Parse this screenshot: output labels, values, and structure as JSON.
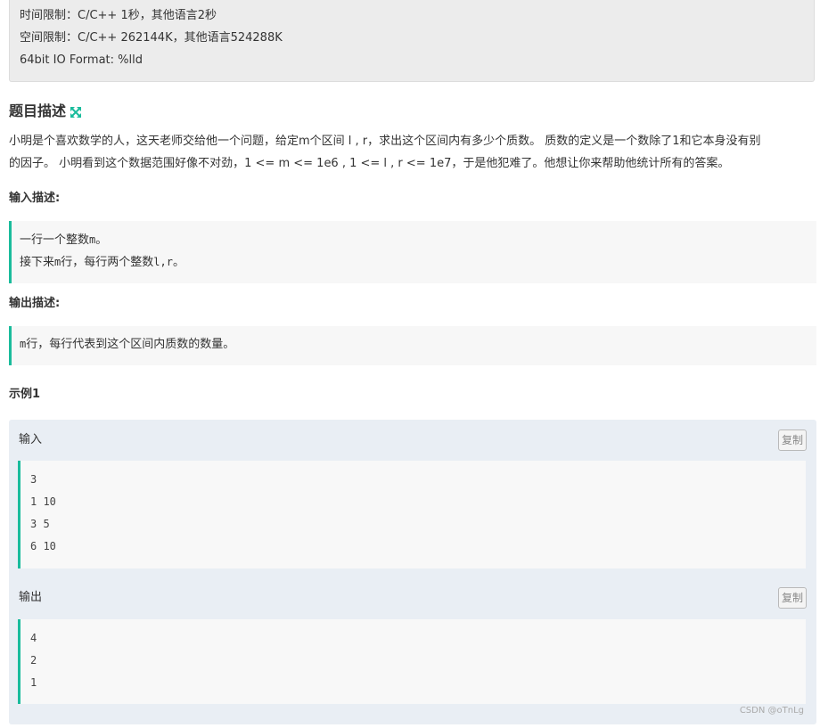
{
  "limits": {
    "time": "时间限制：C/C++ 1秒，其他语言2秒",
    "space": "空间限制：C/C++ 262144K，其他语言524288K",
    "format": "64bit IO Format: %lld"
  },
  "description": {
    "title": "题目描述",
    "text_line1": "小明是个喜欢数学的人，这天老师交给他一个问题，给定m个区间 l , r，求出这个区间内有多少个质数。 质数的定义是一个数除了1和它本身没有别",
    "text_line2": "的因子。 小明看到这个数据范围好像不对劲，1 <= m <= 1e6 , 1 <= l , r <= 1e7，于是他犯难了。他想让你来帮助他统计所有的答案。"
  },
  "input_desc": {
    "label": "输入描述:",
    "line1_a": "一行一个整数",
    "line1_b": "m",
    "line1_c": "。",
    "line2_a": "接下来",
    "line2_b": "m",
    "line2_c": "行，每行两个整数",
    "line2_d": "l,r",
    "line2_e": "。"
  },
  "output_desc": {
    "label": "输出描述:",
    "line1_a": "m",
    "line1_b": "行，每行代表到这个区间内质数的数量。"
  },
  "example": {
    "title": "示例1",
    "input_label": "输入",
    "output_label": "输出",
    "copy_label": "复制",
    "input_lines": [
      "3",
      "1 10",
      "3 5",
      "6 10"
    ],
    "output_lines": [
      "4",
      "2",
      "1"
    ]
  },
  "watermark": "CSDN @oTnLg",
  "colors": {
    "accent": "#1abc9c",
    "limits_bg": "#ececec",
    "example_bg": "#e9eef4"
  },
  "icons": {
    "expand": "expand-arrows-icon"
  }
}
